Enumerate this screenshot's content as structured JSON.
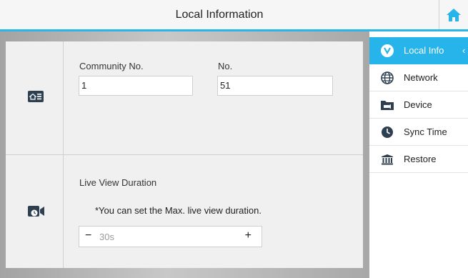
{
  "header": {
    "title": "Local Information",
    "home_icon": "home-icon"
  },
  "sections": {
    "local": {
      "community_label": "Community No.",
      "community_value": "1",
      "no_label": "No.",
      "no_value": "51"
    },
    "live_view": {
      "title": "Live View Duration",
      "note": "*You can set the Max. live view duration.",
      "minus": "−",
      "value": "30s",
      "plus": "+"
    }
  },
  "sidebar": {
    "items": [
      {
        "label": "Local Info",
        "icon": "local-info-icon",
        "active": true
      },
      {
        "label": "Network",
        "icon": "network-icon"
      },
      {
        "label": "Device",
        "icon": "device-icon"
      },
      {
        "label": "Sync Time",
        "icon": "sync-time-icon"
      },
      {
        "label": "Restore",
        "icon": "restore-icon"
      }
    ]
  },
  "colors": {
    "accent": "#27b4ea",
    "icon_dark": "#2e3f50"
  }
}
